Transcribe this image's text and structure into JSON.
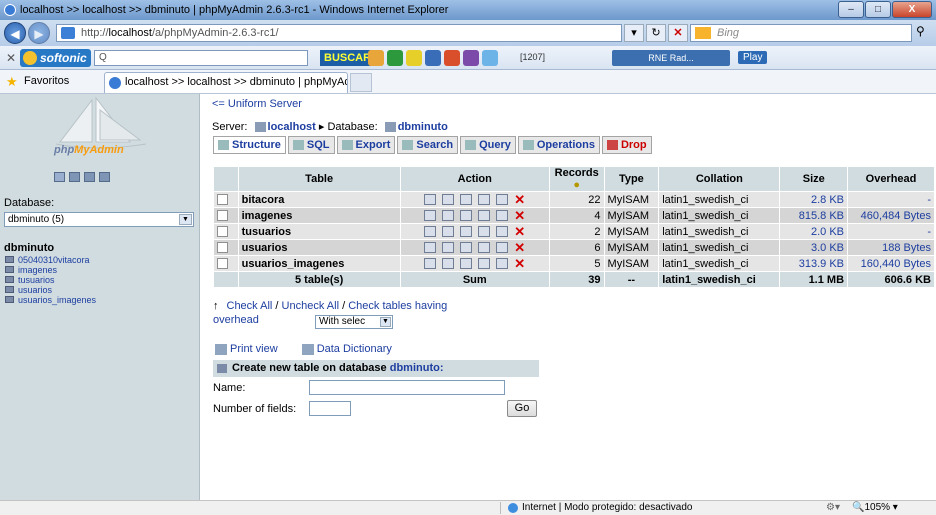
{
  "window": {
    "title": "localhost >> localhost >> dbminuto | phpMyAdmin 2.6.3-rc1 - Windows Internet Explorer",
    "minimize": "–",
    "maximize": "□",
    "close": "X"
  },
  "addressbar": {
    "url_prefix": "http://",
    "url_host": "localhost",
    "url_path": "/a/phpMyAdmin-2.6.3-rc1/",
    "search_placeholder": "Bing"
  },
  "toolbar": {
    "softonic_label": "softonic",
    "search_text": "Q",
    "buscar_label": "BUSCAR",
    "counter": "[1207]",
    "radio_label": "RNE Rad...",
    "play_label": "Play"
  },
  "favorites": {
    "label": "Favoritos",
    "tab_title": "localhost >> localhost >> dbminuto | phpMyAd..."
  },
  "sidebar": {
    "logo_php": "php",
    "logo_myadmin": "MyAdmin",
    "database_label": "Database:",
    "database_select": "dbminuto (5)",
    "db_name": "dbminuto",
    "tables": [
      "05040310vitacora",
      "imagenes",
      "tusuarios",
      "usuarios",
      "usuarios_imagenes"
    ]
  },
  "main": {
    "back_link": "<= Uniform Server",
    "server_label": "Server:",
    "server_name": "localhost",
    "separator": "▸",
    "database_label": "Database:",
    "database_name": "dbminuto",
    "tabs": [
      "Structure",
      "SQL",
      "Export",
      "Search",
      "Query",
      "Operations",
      "Drop"
    ],
    "table_headers": {
      "table": "Table",
      "action": "Action",
      "records": "Records",
      "type": "Type",
      "collation": "Collation",
      "size": "Size",
      "overhead": "Overhead"
    },
    "rows": [
      {
        "name": "bitacora",
        "records": "22",
        "type": "MyISAM",
        "collation": "latin1_swedish_ci",
        "size": "2.8 KB",
        "overhead": "-"
      },
      {
        "name": "imagenes",
        "records": "4",
        "type": "MyISAM",
        "collation": "latin1_swedish_ci",
        "size": "815.8 KB",
        "overhead": "460,484 Bytes"
      },
      {
        "name": "tusuarios",
        "records": "2",
        "type": "MyISAM",
        "collation": "latin1_swedish_ci",
        "size": "2.0 KB",
        "overhead": "-"
      },
      {
        "name": "usuarios",
        "records": "6",
        "type": "MyISAM",
        "collation": "latin1_swedish_ci",
        "size": "3.0 KB",
        "overhead": "188 Bytes"
      },
      {
        "name": "usuarios_imagenes",
        "records": "5",
        "type": "MyISAM",
        "collation": "latin1_swedish_ci",
        "size": "313.9 KB",
        "overhead": "160,440 Bytes"
      }
    ],
    "summary": {
      "tables": "5 table(s)",
      "sum_label": "Sum",
      "records": "39",
      "type": "--",
      "collation": "latin1_swedish_ci",
      "size": "1.1 MB",
      "overhead": "606.6 KB"
    },
    "check_all": "Check All",
    "slash": "/",
    "uncheck_all": "Uncheck All",
    "check_overhead": "Check tables having",
    "overhead_word": "overhead",
    "with_selected": "With selec",
    "print_view": "Print view",
    "data_dictionary": "Data Dictionary",
    "create_prefix": "Create new table on database",
    "create_db": "dbminuto:",
    "name_label": "Name:",
    "fields_label": "Number of fields:",
    "go_label": "Go"
  },
  "status": {
    "zone": "Internet | Modo protegido: desactivado",
    "zoom": "105%"
  },
  "colors": {
    "link_blue": "#1d3ea0",
    "header_bg": "#d0dce0",
    "drop_red": "#c00000",
    "row_light": "#e5e5e5",
    "row_dark": "#d5d5d5"
  }
}
